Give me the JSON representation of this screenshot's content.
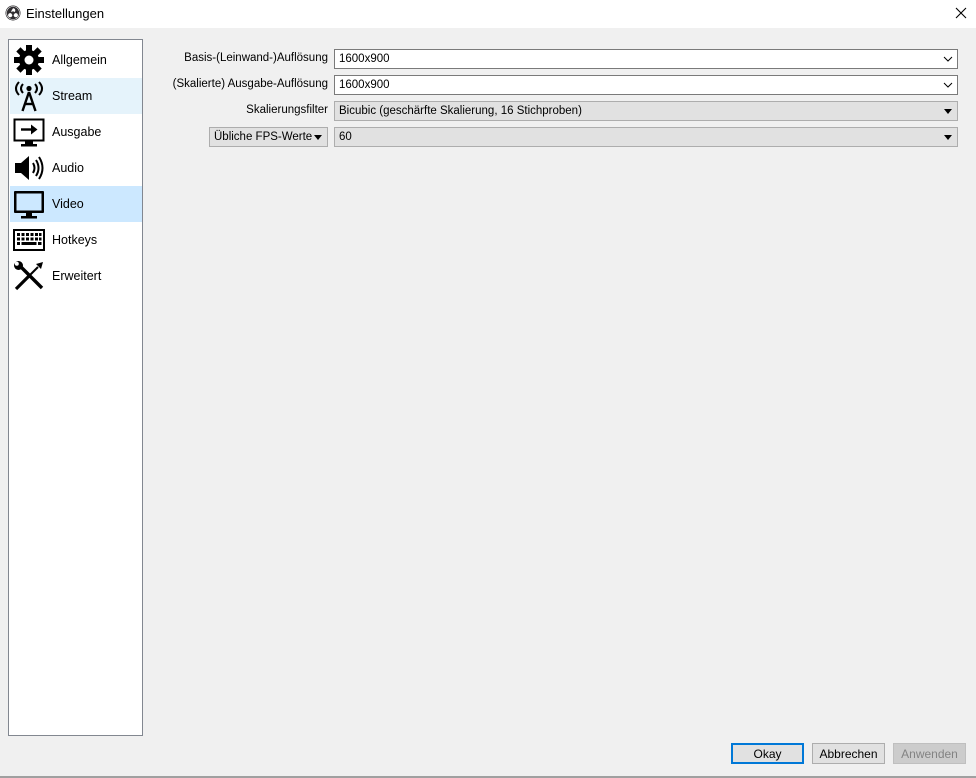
{
  "window": {
    "title": "Einstellungen",
    "icon": "obs-logo-icon"
  },
  "sidebar": {
    "items": [
      {
        "label": "Allgemein",
        "icon": "gear-icon"
      },
      {
        "label": "Stream",
        "icon": "broadcast-antenna-icon"
      },
      {
        "label": "Ausgabe",
        "icon": "output-monitor-icon"
      },
      {
        "label": "Audio",
        "icon": "speaker-icon"
      },
      {
        "label": "Video",
        "icon": "monitor-icon"
      },
      {
        "label": "Hotkeys",
        "icon": "keyboard-icon"
      },
      {
        "label": "Erweitert",
        "icon": "wrench-screwdriver-icon"
      }
    ],
    "selected": "Video",
    "hovered": "Stream"
  },
  "video": {
    "base_resolution": {
      "label": "Basis-(Leinwand-)Auflösung",
      "value": "1600x900"
    },
    "output_resolution": {
      "label": "(Skalierte) Ausgabe-Auflösung",
      "value": "1600x900"
    },
    "scale_filter": {
      "label": "Skalierungsfilter",
      "value": "Bicubic (geschärfte Skalierung, 16 Stichproben)"
    },
    "fps_mode": {
      "value": "Übliche FPS-Werte"
    },
    "fps_value": {
      "value": "60"
    }
  },
  "buttons": {
    "ok": "Okay",
    "cancel": "Abbrechen",
    "apply": "Anwenden"
  },
  "colors": {
    "selected_bg": "#cce8ff",
    "hover_bg": "#e5f3fb",
    "primary_border": "#0078d7"
  }
}
